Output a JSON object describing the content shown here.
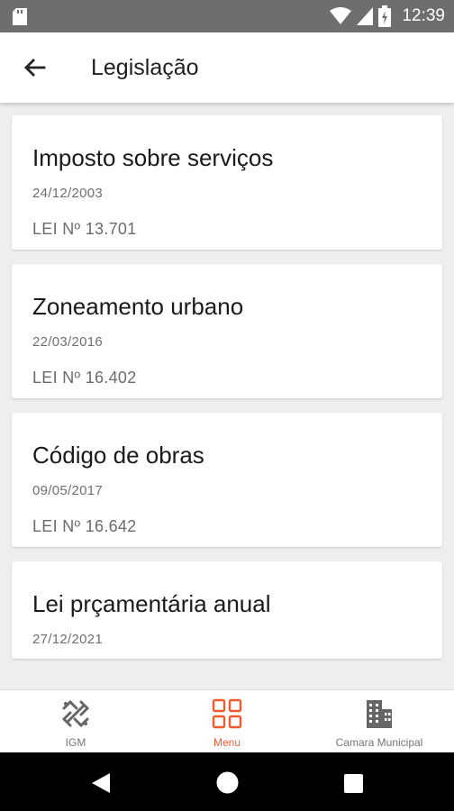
{
  "status_bar": {
    "time": "12:39"
  },
  "app_bar": {
    "title": "Legislação"
  },
  "laws": [
    {
      "title": "Imposto sobre serviços",
      "date": "24/12/2003",
      "number": "LEI Nº 13.701"
    },
    {
      "title": "Zoneamento urbano",
      "date": "22/03/2016",
      "number": "LEI Nº 16.402"
    },
    {
      "title": "Código de obras",
      "date": "09/05/2017",
      "number": "LEI Nº 16.642"
    },
    {
      "title": "Lei prçamentária anual",
      "date": "27/12/2021",
      "number": ""
    }
  ],
  "bottom_nav": {
    "items": [
      {
        "label": "IGM",
        "icon": "igm-logo-icon",
        "active": false
      },
      {
        "label": "Menu",
        "icon": "grid-icon",
        "active": true
      },
      {
        "label": "Camara Municipal",
        "icon": "building-icon",
        "active": false
      }
    ],
    "active_color": "#ef5b2f"
  }
}
